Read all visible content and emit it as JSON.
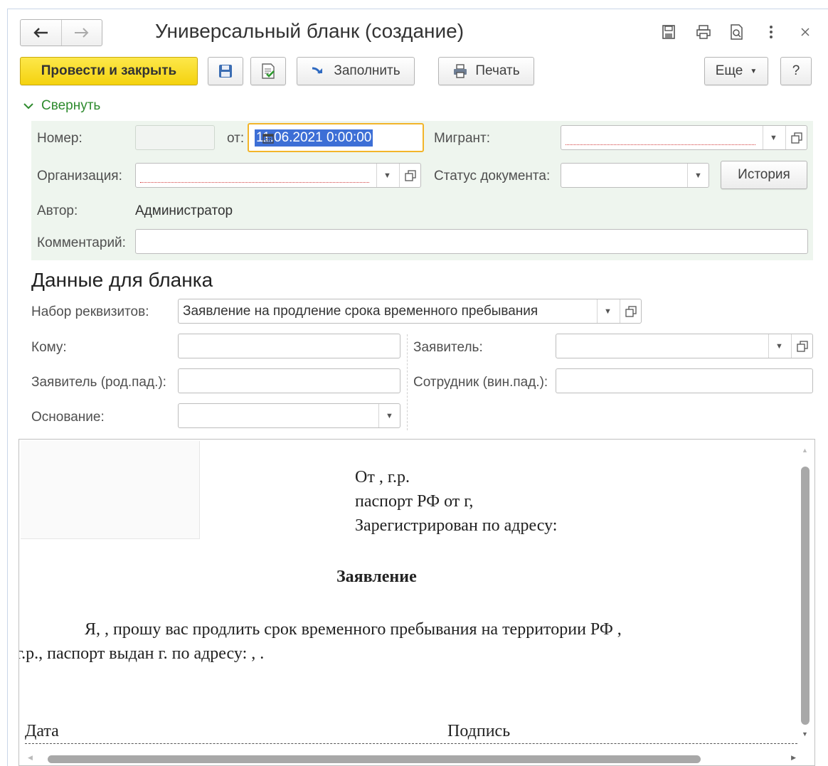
{
  "window": {
    "title": "Универсальный бланк (создание)"
  },
  "toolbar": {
    "post_close": "Провести и закрыть",
    "fill": "Заполнить",
    "print": "Печать",
    "more": "Еще",
    "help": "?"
  },
  "collapse": {
    "label": "Свернуть"
  },
  "header": {
    "number_label": "Номер:",
    "number_value": "",
    "date_from_label": "от:",
    "date_value": "11.06.2021  0:00:00",
    "migrant_label": "Мигрант:",
    "org_label": "Организация:",
    "status_label": "Статус документа:",
    "history_button": "История",
    "author_label": "Автор:",
    "author_value": "Администратор",
    "comment_label": "Комментарий:"
  },
  "blank": {
    "section_title": "Данные для бланка",
    "set_label": "Набор реквизитов:",
    "set_value": "Заявление на продление срока временного пребывания",
    "to_label": "Кому:",
    "applicant_label": "Заявитель:",
    "applicant_gen_label": "Заявитель (род.пад.):",
    "employee_label": "Сотрудник (вин.пад.):",
    "basis_label": "Основание:"
  },
  "document": {
    "line1": "От ,  г.р.",
    "line2": "паспорт РФ    от  г,",
    "line3": "Зарегистрирован по адресу:",
    "heading": "Заявление",
    "para1": "Я, , прошу вас продлить срок временного пребывания на территории РФ ,",
    "para2": "г.р., паспорт   выдан  г. по адресу: , .",
    "date_label": "Дата",
    "sign_label": "Подпись"
  },
  "colors": {
    "primary_button": "#f4d20f",
    "panel_green": "#eef5ee",
    "collapse_green": "#2e8b2e",
    "required_red": "#d23a3a",
    "focus_orange": "#f2b52a",
    "selection_blue": "#3d6fd6"
  }
}
